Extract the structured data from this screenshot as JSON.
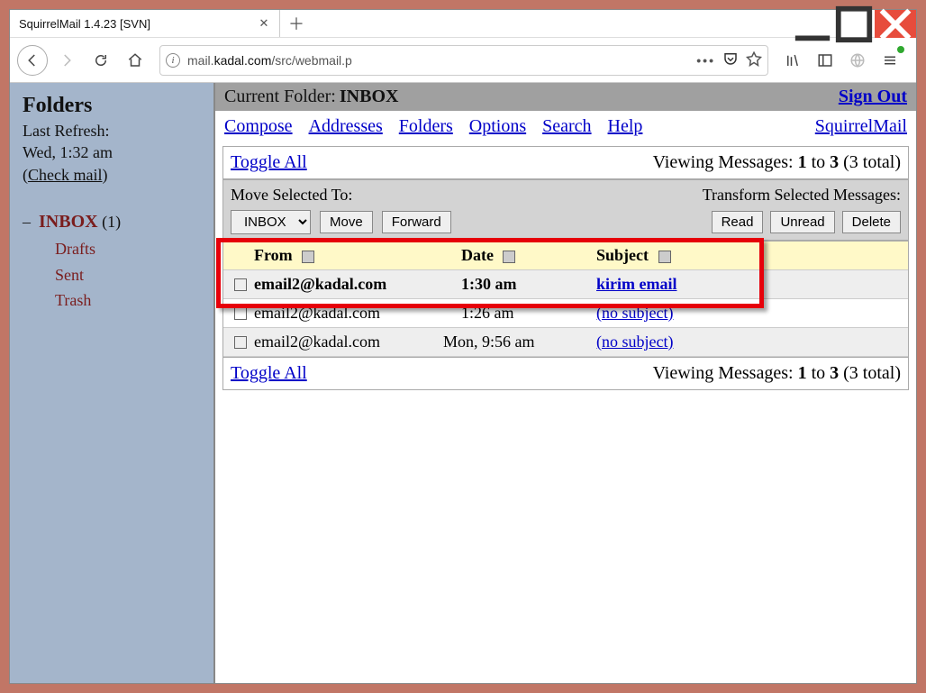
{
  "browser": {
    "tab_title": "SquirrelMail 1.4.23 [SVN]",
    "url_prefix": "mail.",
    "url_host": "kadal.com",
    "url_path": "/src/webmail.p"
  },
  "sidebar": {
    "heading": "Folders",
    "last_refresh_label": "Last Refresh:",
    "last_refresh_time": "Wed, 1:32 am",
    "check_mail": "Check mail",
    "inbox_dash": "–",
    "inbox_label": "INBOX",
    "inbox_count": "(1)",
    "folders": [
      "Drafts",
      "Sent",
      "Trash"
    ]
  },
  "header": {
    "current_folder_label": "Current Folder:",
    "current_folder_name": "INBOX",
    "signout": "Sign Out",
    "nav": [
      "Compose",
      "Addresses",
      "Folders",
      "Options",
      "Search",
      "Help"
    ],
    "brand": "SquirrelMail"
  },
  "list": {
    "toggle_all": "Toggle All",
    "viewing_prefix": "Viewing Messages: ",
    "viewing_from": "1",
    "viewing_to_word": " to ",
    "viewing_to": "3",
    "viewing_suffix": " (3 total)"
  },
  "actions": {
    "move_label": "Move Selected To:",
    "transform_label": "Transform Selected Messages:",
    "move_select": "INBOX",
    "move_btn": "Move",
    "forward_btn": "Forward",
    "read_btn": "Read",
    "unread_btn": "Unread",
    "delete_btn": "Delete"
  },
  "columns": {
    "from": "From",
    "date": "Date",
    "subject": "Subject"
  },
  "messages": [
    {
      "from": "email2@kadal.com",
      "date": "1:30 am",
      "subject": "kirim email",
      "unread": true
    },
    {
      "from": "email2@kadal.com",
      "date": "1:26 am",
      "subject": "(no subject)",
      "unread": false
    },
    {
      "from": "email2@kadal.com",
      "date": "Mon, 9:56 am",
      "subject": "(no subject)",
      "unread": false
    }
  ]
}
